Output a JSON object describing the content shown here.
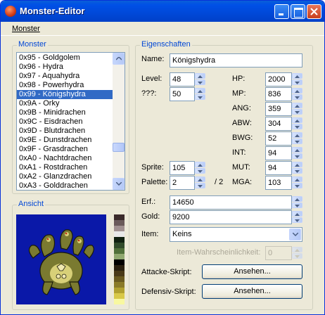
{
  "window": {
    "title": "Monster-Editor"
  },
  "menu": {
    "monster": "Monster"
  },
  "monster_group": {
    "title": "Monster",
    "items": [
      "0x95 - Goldgolem",
      "0x96 - Hydra",
      "0x97 - Aquahydra",
      "0x98 - Powerhydra",
      "0x99 - Königshydra",
      "0x9A - Orky",
      "0x9B - Minidrachen",
      "0x9C - Eisdrachen",
      "0x9D - Blutdrachen",
      "0x9E - Dunstdrachen",
      "0x9F - Grasdrachen",
      "0xA0 - Nachtdrachen",
      "0xA1 - Rostdrachen",
      "0xA2 - Glanzdrachen",
      "0xA3 - Golddrachen"
    ],
    "selected_index": 4
  },
  "ansicht": {
    "title": "Ansicht",
    "palette_colors": [
      "#3a2a2a",
      "#6a5a5a",
      "#a09090",
      "#e8e8e8",
      "#102010",
      "#304a2a",
      "#50703a",
      "#90a870",
      "#000000",
      "#2a2010",
      "#4a3a18",
      "#6a5a20",
      "#8a7a28",
      "#b0a030",
      "#d8c848",
      "#f8f8a0"
    ]
  },
  "eigenschaften": {
    "title": "Eigenschaften",
    "name_label": "Name:",
    "name_value": "Königshydra",
    "level_label": "Level:",
    "level_value": "48",
    "unknown_label": "???:",
    "unknown_value": "50",
    "sprite_label": "Sprite:",
    "sprite_value": "105",
    "palette_label": "Palette:",
    "palette_value": "2",
    "palette_max": "/ 2",
    "stats": [
      {
        "label": "HP:",
        "value": "2000"
      },
      {
        "label": "MP:",
        "value": "836"
      },
      {
        "label": "ANG:",
        "value": "359"
      },
      {
        "label": "ABW:",
        "value": "304"
      },
      {
        "label": "BWG:",
        "value": "52"
      },
      {
        "label": "INT:",
        "value": "94"
      },
      {
        "label": "MUT:",
        "value": "94"
      },
      {
        "label": "MGA:",
        "value": "103"
      }
    ],
    "erf_label": "Erf.:",
    "erf_value": "14650",
    "gold_label": "Gold:",
    "gold_value": "9200",
    "item_label": "Item:",
    "item_value": "Keins",
    "item_chance_label": "Item-Wahrscheinlichkeit:",
    "item_chance_value": "0",
    "attack_label": "Attacke-Skript:",
    "attack_button": "Ansehen...",
    "defense_label": "Defensiv-Skript:",
    "defense_button": "Ansehen..."
  }
}
